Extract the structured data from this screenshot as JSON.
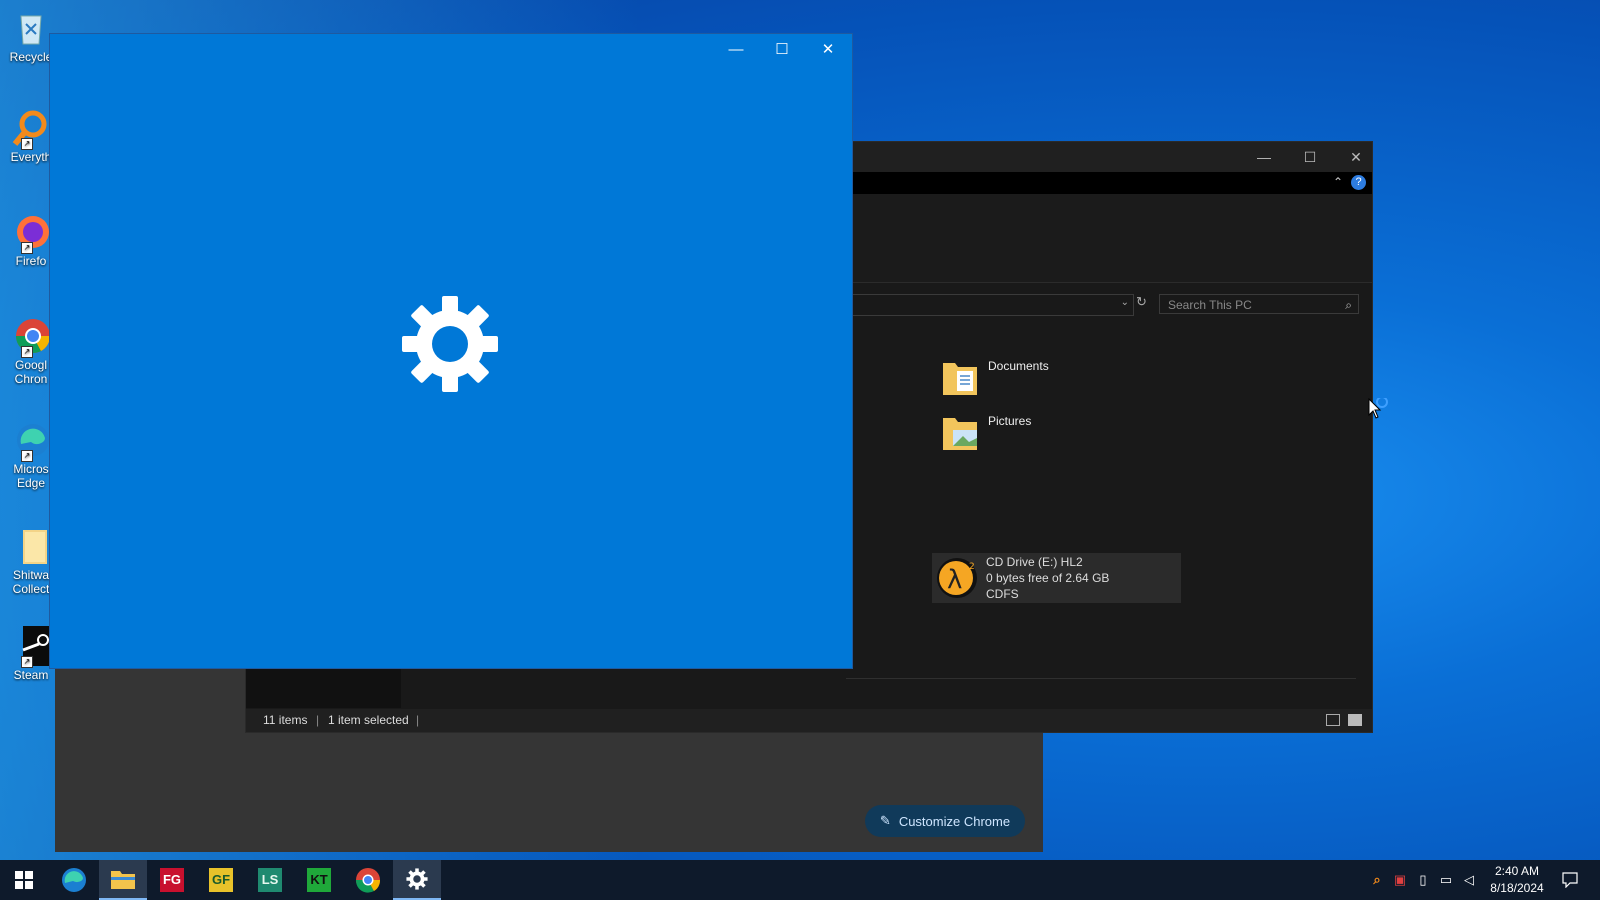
{
  "desktop": {
    "icons": [
      {
        "label": "Recycle"
      },
      {
        "label": "Everyth"
      },
      {
        "label": "Firefo"
      },
      {
        "label": "Googl Chron"
      },
      {
        "label": "Micros Edge"
      },
      {
        "label": "Shitwa Collect"
      },
      {
        "label": "Steam"
      }
    ]
  },
  "settings_window": {
    "minimize": "—",
    "maximize": "☐",
    "close": "✕",
    "icon": "gear-icon"
  },
  "explorer": {
    "search_placeholder": "Search This PC",
    "folders": [
      {
        "name": "Documents"
      },
      {
        "name": "Pictures"
      }
    ],
    "drive": {
      "name": "CD Drive (E:) HL2",
      "space": "0 bytes free of 2.64 GB",
      "fs": "CDFS"
    },
    "status": {
      "items": "11 items",
      "selected": "1 item selected"
    }
  },
  "chrome": {
    "customize_label": "Customize Chrome"
  },
  "taskbar": {
    "time": "2:40 AM",
    "date": "8/18/2024",
    "apps": [
      "start",
      "edge",
      "file-explorer",
      "fg",
      "gf",
      "ls",
      "kt",
      "chrome",
      "settings"
    ]
  }
}
